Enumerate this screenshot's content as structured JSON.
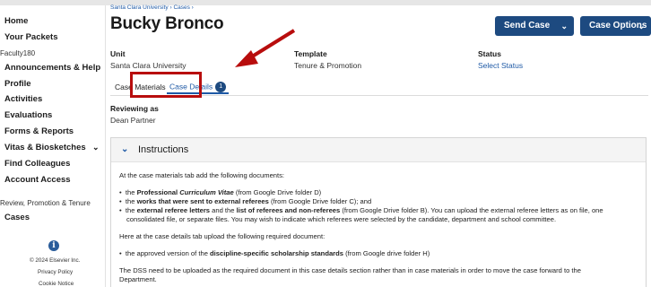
{
  "sidebar": {
    "items": [
      {
        "label": "Home"
      },
      {
        "label": "Your Packets"
      },
      {
        "label": "Faculty180"
      },
      {
        "label": "Announcements & Help"
      },
      {
        "label": "Profile"
      },
      {
        "label": "Activities"
      },
      {
        "label": "Evaluations"
      },
      {
        "label": "Forms & Reports"
      },
      {
        "label": "Vitas & Biosketches"
      },
      {
        "label": "Find Colleagues"
      },
      {
        "label": "Account Access"
      },
      {
        "label": "Review, Promotion & Tenure"
      },
      {
        "label": "Cases"
      }
    ],
    "vitas_chevron": "⌄",
    "footer": {
      "icon": "info-icon",
      "icon_glyph": "i",
      "copyright": "© 2024 Elsevier Inc.",
      "privacy": "Privacy Policy",
      "cookie": "Cookie Notice"
    }
  },
  "header": {
    "breadcrumb": "Santa Clara University  ›  Cases  ›",
    "candidate_name": "Bucky Bronco",
    "send_case_label": "Send Case",
    "case_options_label": "Case Options",
    "caret": "⌄"
  },
  "summary": {
    "unit_label": "Unit",
    "unit_value": "Santa Clara University",
    "template_label": "Template",
    "template_value": "Tenure & Promotion",
    "status_label": "Status",
    "status_value": "Select Status"
  },
  "tabs": [
    {
      "label": "Case Materials"
    },
    {
      "label": "Case Details",
      "badge": "1"
    }
  ],
  "reviewing": {
    "label": "Reviewing as",
    "value": "Dean Partner"
  },
  "instructions": {
    "title": "Instructions",
    "intro": "At the case materials tab add the following documents:",
    "bullets_1": [
      {
        "pre": "the ",
        "b1": "Professional ",
        "i1": "Curriculum Vitae",
        "post": " (from Google Drive folder D)"
      },
      {
        "pre": "the ",
        "b1": "works that were sent to external referees",
        "post": " (from Google Drive folder C); and"
      },
      {
        "pre": "the ",
        "b1": "external referee letters",
        "mid": " and the ",
        "b2": "list of referees and non-referees",
        "post": " (from Google Drive folder B).  You can upload the external referee letters as on file, one"
      }
    ],
    "bullet_3_cont": "consolidated file, or separate files.  You may wish to indicate which referees were selected by the candidate, department and school committee.",
    "details_intro": "Here at the case details tab upload the following required document:",
    "bullet_2": {
      "pre": "the approved version of the ",
      "b1": "discipline-specific scholarship standards",
      "post": " (from Google drive folder H)"
    },
    "dss_line_1": "The DSS need to be uploaded as the required document in this case details section rather than in case materials in order to move the case forward to the",
    "dss_line_2": "Department."
  },
  "annotation": {
    "highlight_color": "#b80d0d"
  },
  "colors": {
    "brand": "#1d4a80",
    "link": "#1f5aa6"
  }
}
